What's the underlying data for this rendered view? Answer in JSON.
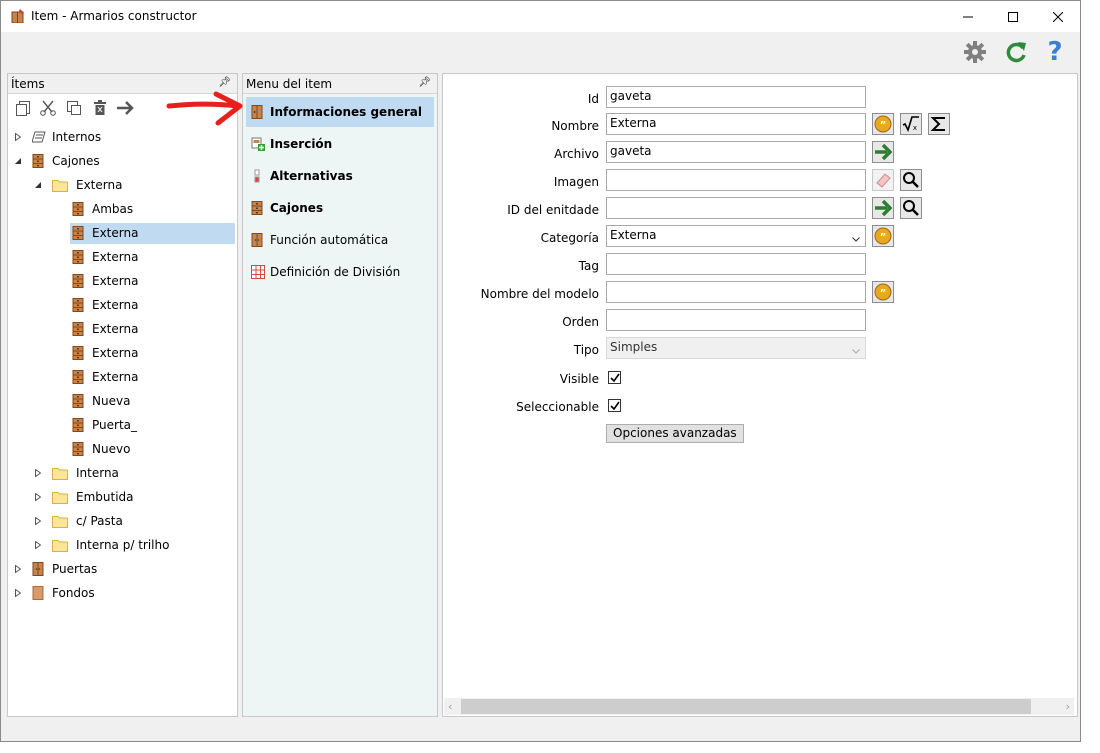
{
  "window": {
    "title": "Item - Armarios constructor",
    "controls": [
      "minimize-icon",
      "maximize-icon",
      "close-icon"
    ]
  },
  "toolbar": {
    "icons": [
      "gear-icon",
      "refresh-icon",
      "help-icon"
    ],
    "colors": {
      "gear": "#808080",
      "refresh": "#2e8b3c",
      "help": "#3a7fd5"
    }
  },
  "items_panel": {
    "header": "Ítems",
    "pin": "pin-icon",
    "tools": [
      "copy-icon",
      "cut-icon",
      "duplicate-icon",
      "delete-icon",
      "arrow-right-icon"
    ],
    "tree": [
      {
        "label": "Internos",
        "icon": "internos-icon",
        "level": 0,
        "expander": "collapsed"
      },
      {
        "label": "Cajones",
        "icon": "drawer-icon",
        "level": 0,
        "expander": "expanded"
      },
      {
        "label": "Externa",
        "icon": "folder-icon",
        "level": 1,
        "expander": "expanded"
      },
      {
        "label": "Ambas",
        "icon": "drawer-icon",
        "level": 2,
        "expander": "none"
      },
      {
        "label": "Externa",
        "icon": "drawer-icon",
        "level": 2,
        "expander": "none",
        "selected": true
      },
      {
        "label": "Externa",
        "icon": "drawer-icon",
        "level": 2,
        "expander": "none"
      },
      {
        "label": "Externa",
        "icon": "drawer-icon",
        "level": 2,
        "expander": "none"
      },
      {
        "label": "Externa",
        "icon": "drawer-icon",
        "level": 2,
        "expander": "none"
      },
      {
        "label": "Externa",
        "icon": "drawer-icon",
        "level": 2,
        "expander": "none"
      },
      {
        "label": "Externa",
        "icon": "drawer-icon",
        "level": 2,
        "expander": "none"
      },
      {
        "label": "Externa",
        "icon": "drawer-icon",
        "level": 2,
        "expander": "none"
      },
      {
        "label": "Nueva",
        "icon": "drawer-icon",
        "level": 2,
        "expander": "none"
      },
      {
        "label": "Puerta_",
        "icon": "drawer-icon",
        "level": 2,
        "expander": "none"
      },
      {
        "label": "Nuevo",
        "icon": "drawer-icon",
        "level": 2,
        "expander": "none"
      },
      {
        "label": "Interna",
        "icon": "folder-icon",
        "level": 1,
        "expander": "collapsed"
      },
      {
        "label": "Embutida",
        "icon": "folder-icon",
        "level": 1,
        "expander": "collapsed"
      },
      {
        "label": "c/ Pasta",
        "icon": "folder-icon",
        "level": 1,
        "expander": "collapsed"
      },
      {
        "label": "Interna p/ trilho",
        "icon": "folder-icon",
        "level": 1,
        "expander": "collapsed"
      },
      {
        "label": "Puertas",
        "icon": "door-icon",
        "level": 0,
        "expander": "collapsed"
      },
      {
        "label": "Fondos",
        "icon": "panel-icon",
        "level": 0,
        "expander": "collapsed"
      }
    ]
  },
  "menu_panel": {
    "header": "Menu del item",
    "pin": "pin-icon",
    "items": [
      {
        "label": "Informaciones general",
        "icon": "info-drawer-icon",
        "selected": true,
        "bold": true
      },
      {
        "label": "Inserción",
        "icon": "insert-icon",
        "bold": true
      },
      {
        "label": "Alternativas",
        "icon": "alternatives-icon",
        "bold": true
      },
      {
        "label": "Cajones",
        "icon": "drawer-icon",
        "bold": true
      },
      {
        "label": "Función automática",
        "icon": "door-icon",
        "bold": false
      },
      {
        "label": "Definición de División",
        "icon": "grid-icon",
        "bold": false
      }
    ]
  },
  "form": {
    "fields": [
      {
        "label": "Id",
        "value": "gaveta",
        "type": "text",
        "buttons": []
      },
      {
        "label": "Nombre",
        "value": "Externa",
        "type": "text",
        "buttons": [
          "translate-icon",
          "formula-icon",
          "sum-icon"
        ]
      },
      {
        "label": "Archivo",
        "value": "gaveta",
        "type": "text",
        "buttons": [
          "arrow-right-icon"
        ]
      },
      {
        "label": "Imagen",
        "value": "",
        "type": "text",
        "buttons": [
          "eraser-icon",
          "search-icon"
        ]
      },
      {
        "label": "ID del enitdade",
        "value": "",
        "type": "text",
        "buttons": [
          "arrow-right-icon",
          "search-icon"
        ]
      },
      {
        "label": "Categoría",
        "value": "Externa",
        "type": "select",
        "buttons": [
          "translate-icon"
        ]
      },
      {
        "label": "Tag",
        "value": "",
        "type": "text",
        "buttons": []
      },
      {
        "label": "Nombre del modelo",
        "value": "",
        "type": "text",
        "buttons": [
          "translate-icon"
        ]
      },
      {
        "label": "Orden",
        "value": "",
        "type": "text",
        "buttons": []
      },
      {
        "label": "Tipo",
        "value": "Simples",
        "type": "select-disabled",
        "buttons": []
      }
    ],
    "visible": {
      "label": "Visible",
      "checked": true
    },
    "selectable": {
      "label": "Seleccionable",
      "checked": true
    },
    "advanced_button": "Opciones avanzadas"
  },
  "annotation": {
    "arrow_color": "#e8201c"
  }
}
